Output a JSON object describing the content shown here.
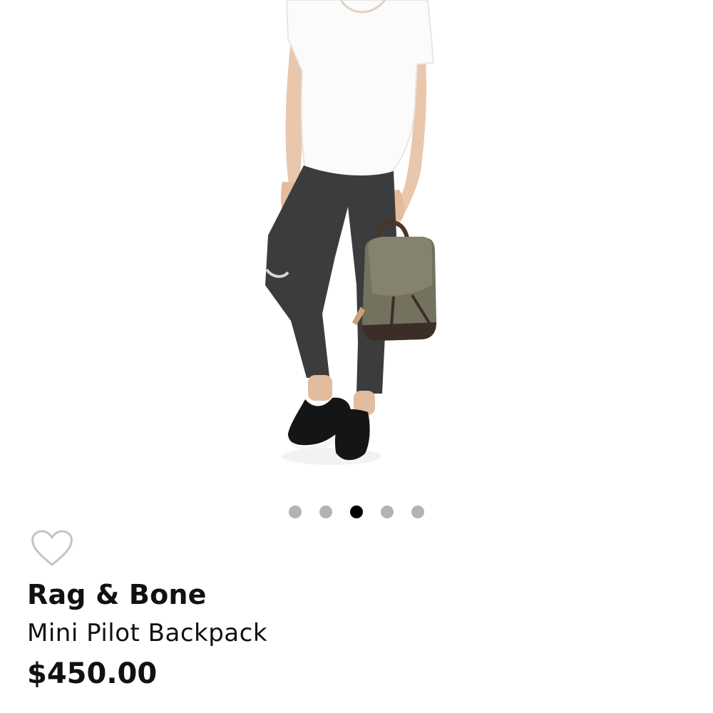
{
  "product": {
    "brand": "Rag & Bone",
    "name": "Mini Pilot Backpack",
    "price": "$450.00",
    "image_icon": "model-wearing-backpack-photo"
  },
  "carousel": {
    "total": 5,
    "active_index": 2
  },
  "favorite": {
    "icon": "heart-outline-icon",
    "saved": false
  },
  "colors": {
    "dot_inactive": "#b3b3b3",
    "dot_active": "#000000",
    "text": "#111111"
  }
}
